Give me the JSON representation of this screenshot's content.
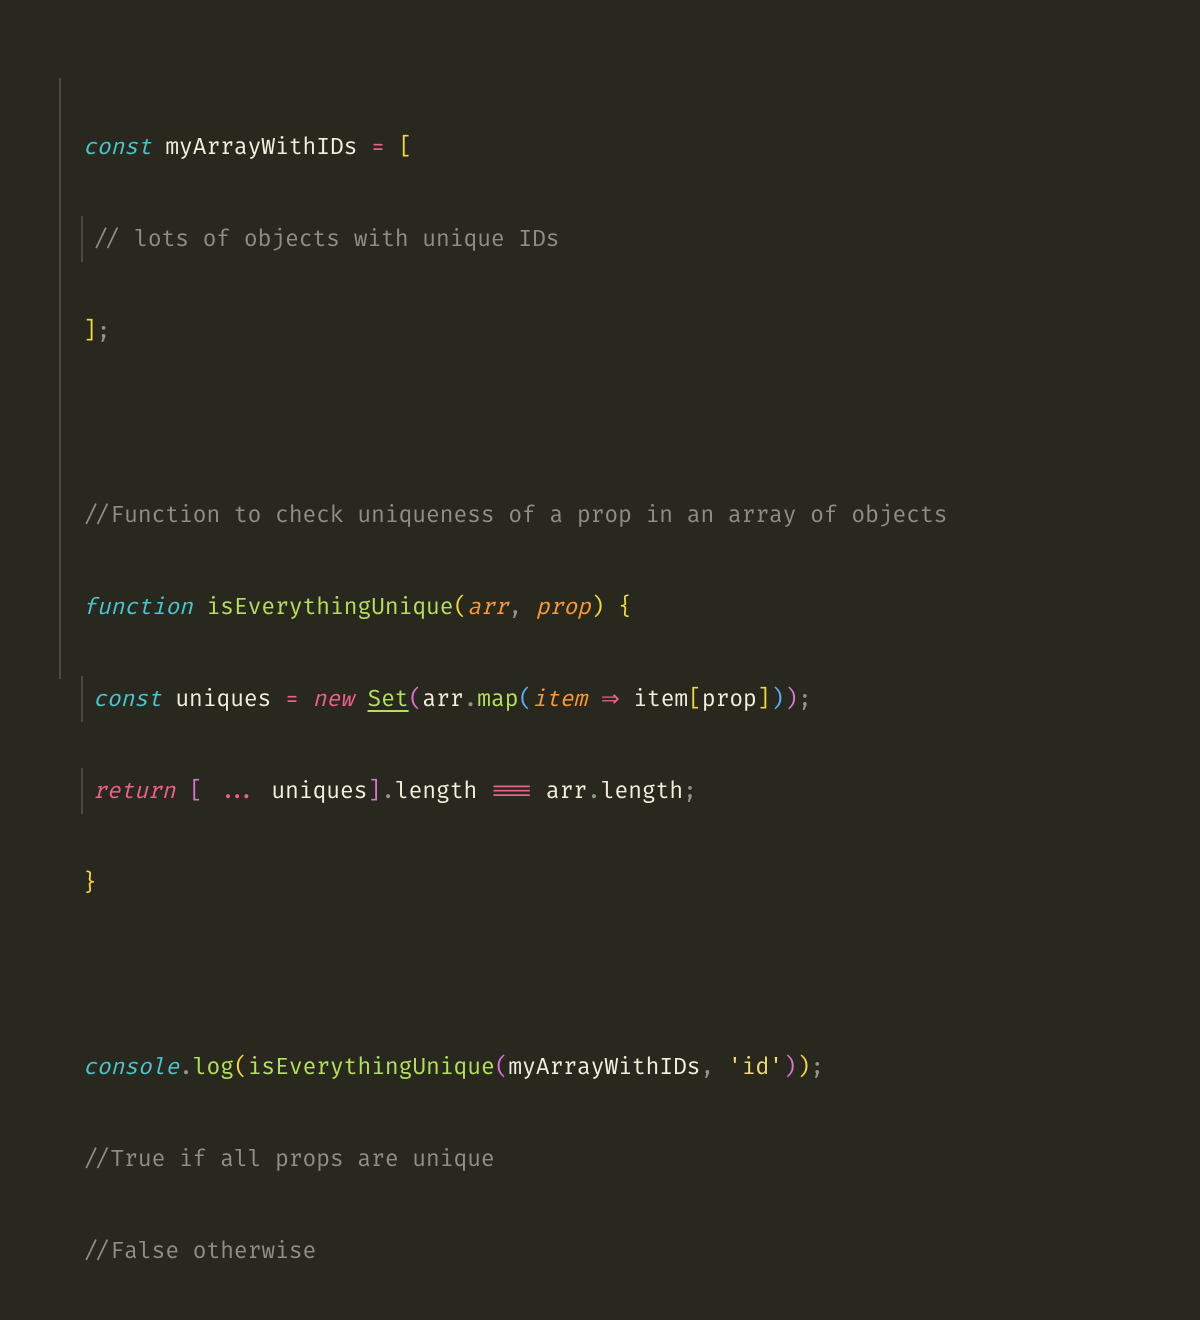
{
  "code": {
    "l1": {
      "kw_const": "const",
      "var": " myArrayWithIDs ",
      "eq": "=",
      "sp": " ",
      "br_open": "["
    },
    "l2": {
      "comment": "// lots of objects with unique IDs"
    },
    "l3": {
      "br_close": "]",
      "semi": ";"
    },
    "l5": {
      "comment": "//Function to check uniqueness of a prop in an array of objects"
    },
    "l6": {
      "kw_fn": "function",
      "sp1": " ",
      "fn": "isEverythingUnique",
      "p_open": "(",
      "param1": "arr",
      "comma": ",",
      "sp2": " ",
      "param2": "prop",
      "p_close": ")",
      "sp3": " ",
      "brace_open": "{"
    },
    "l7": {
      "kw_const": "const",
      "var": " uniques ",
      "eq": "=",
      "sp1": " ",
      "kw_new": "new",
      "sp2": " ",
      "type": "Set",
      "p1_open": "(",
      "arr": "arr",
      "dot": ".",
      "method": "map",
      "p2_open": "(",
      "param": "item",
      "sp3": " ",
      "arrow": "⇒",
      "sp4": " ",
      "item": "item",
      "br_open": "[",
      "prop": "prop",
      "br_close": "]",
      "p2_close": ")",
      "p1_close": ")",
      "semi": ";"
    },
    "l8": {
      "kw_return": "return",
      "sp1": " ",
      "br_open": "[",
      "spread": " ... ",
      "uniques": "uniques",
      "br_close": "]",
      "dot1": ".",
      "len1": "length ",
      "op": "===",
      "sp2": " ",
      "arr": "arr",
      "dot2": ".",
      "len2": "length",
      "semi": ";"
    },
    "l9": {
      "brace_close": "}"
    },
    "l11": {
      "obj": "console",
      "dot": ".",
      "method": "log",
      "p1_open": "(",
      "fn": "isEverythingUnique",
      "p2_open": "(",
      "arg1": "myArrayWithIDs",
      "comma": ",",
      "sp": " ",
      "str": "'id'",
      "p2_close": ")",
      "p1_close": ")",
      "semi": ";"
    },
    "l12": {
      "comment": "//True if all props are unique"
    },
    "l13": {
      "comment": "//False otherwise"
    }
  }
}
